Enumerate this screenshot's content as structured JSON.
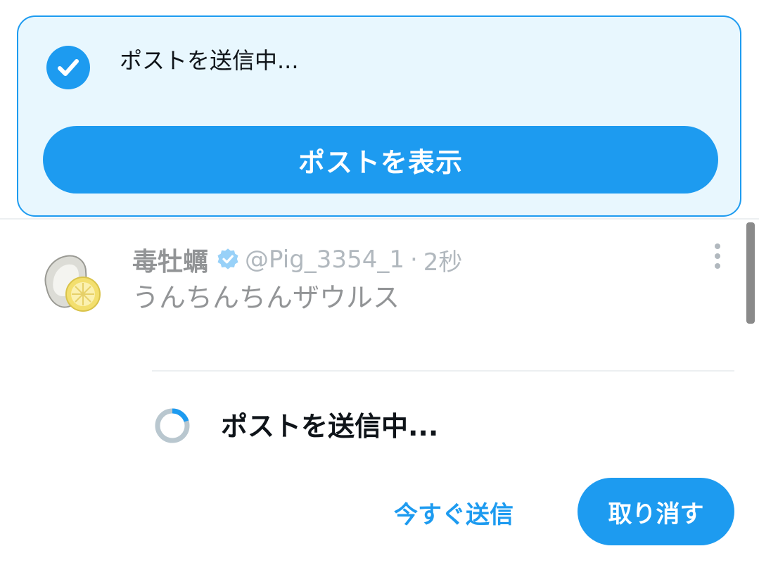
{
  "toast": {
    "message": "ポストを送信中...",
    "view_post_label": "ポストを表示",
    "icon": "check-circle-icon"
  },
  "tweet": {
    "author_name": "毒牡蠣",
    "verified": true,
    "handle": "@Pig_3354_1",
    "separator": "·",
    "time": "2秒",
    "text": "うんちんちんザウルス",
    "more_icon": "more-vertical-icon"
  },
  "status": {
    "sending_text": "ポストを送信中...",
    "progress": 0.2,
    "icon": "progress-spinner-icon"
  },
  "actions": {
    "send_now_label": "今すぐ送信",
    "undo_label": "取り消す"
  },
  "colors": {
    "accent": "#1d9bf0",
    "toast_background": "#e8f7fe",
    "text_primary": "#0f1419",
    "text_secondary": "#536471",
    "spinner_track": "#b9c7cf"
  }
}
